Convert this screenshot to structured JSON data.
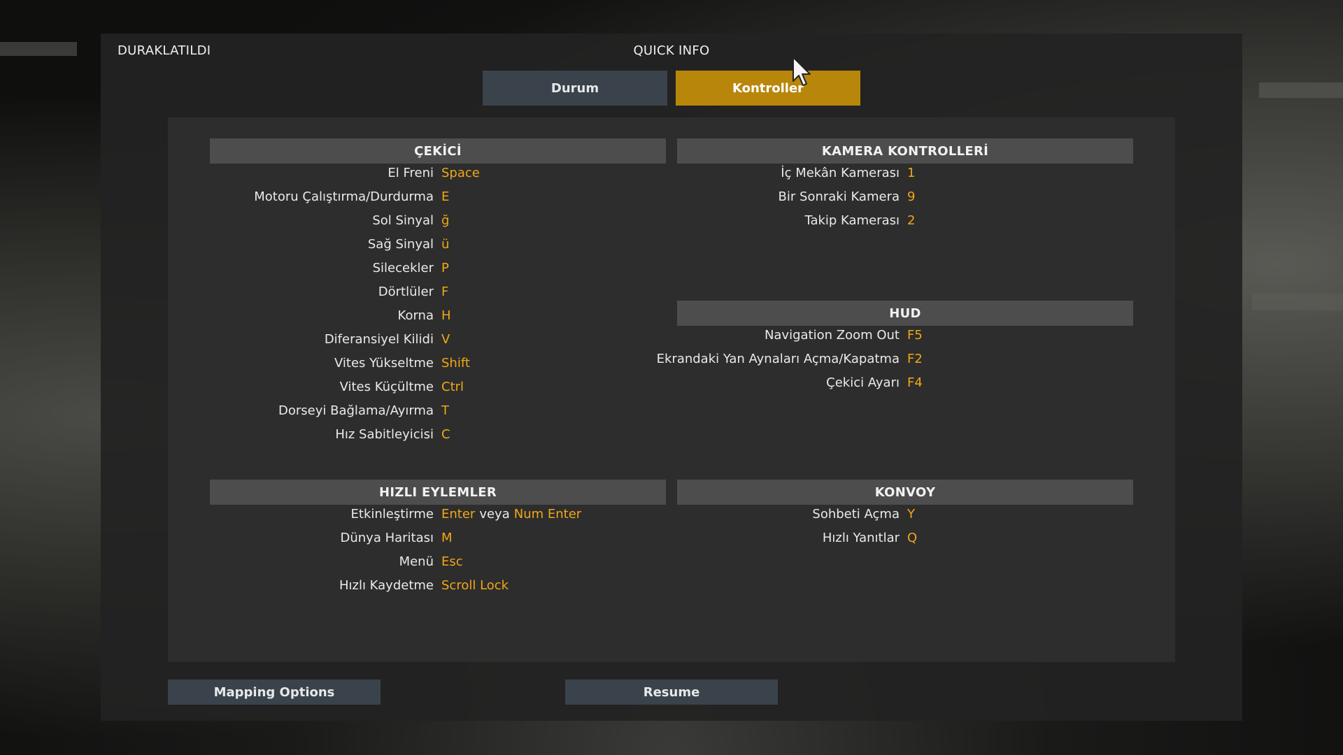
{
  "header": {
    "status": "DURAKLATILDI",
    "title": "QUICK INFO",
    "tabs": [
      {
        "label": "Durum",
        "active": false
      },
      {
        "label": "Kontroller",
        "active": true
      }
    ]
  },
  "colors": {
    "accent": "#b8860b",
    "key_text": "#f0a816",
    "button": "#3a434b",
    "section_header": "#4d4d4d"
  },
  "sections": {
    "cekici": {
      "title": "ÇEKİCİ",
      "rows": [
        {
          "label": "El Freni",
          "key": "Space"
        },
        {
          "label": "Motoru Çalıştırma/Durdurma",
          "key": "E"
        },
        {
          "label": "Sol Sinyal",
          "key": "ğ"
        },
        {
          "label": "Sağ Sinyal",
          "key": "ü"
        },
        {
          "label": "Silecekler",
          "key": "P"
        },
        {
          "label": "Dörtlüler",
          "key": "F"
        },
        {
          "label": "Korna",
          "key": "H"
        },
        {
          "label": "Diferansiyel Kilidi",
          "key": "V"
        },
        {
          "label": "Vites Yükseltme",
          "key": "Shift"
        },
        {
          "label": "Vites Küçültme",
          "key": "Ctrl"
        },
        {
          "label": "Dorseyi Bağlama/Ayırma",
          "key": "T"
        },
        {
          "label": "Hız Sabitleyicisi",
          "key": "C"
        }
      ]
    },
    "kamera": {
      "title": "KAMERA KONTROLLERİ",
      "rows": [
        {
          "label": "İç Mekân Kamerası",
          "key": "1"
        },
        {
          "label": "Bir Sonraki Kamera",
          "key": "9"
        },
        {
          "label": "Takip Kamerası",
          "key": "2"
        }
      ]
    },
    "hud": {
      "title": "HUD",
      "rows": [
        {
          "label": "Navigation Zoom Out",
          "key": "F5"
        },
        {
          "label": "Ekrandaki Yan Aynaları Açma/Kapatma",
          "key": "F2"
        },
        {
          "label": "Çekici Ayarı",
          "key": "F4"
        }
      ]
    },
    "hizli": {
      "title": "HIZLI EYLEMLER",
      "rows": [
        {
          "label": "Etkinleştirme",
          "key": "Enter",
          "sep": "veya",
          "key2": "Num Enter"
        },
        {
          "label": "Dünya Haritası",
          "key": "M"
        },
        {
          "label": "Menü",
          "key": "Esc"
        },
        {
          "label": "Hızlı Kaydetme",
          "key": "Scroll Lock"
        }
      ]
    },
    "konvoy": {
      "title": "KONVOY",
      "rows": [
        {
          "label": "Sohbeti Açma",
          "key": "Y"
        },
        {
          "label": "Hızlı Yanıtlar",
          "key": "Q"
        }
      ]
    }
  },
  "footer": {
    "mapping_label": "Mapping Options",
    "resume_label": "Resume"
  }
}
